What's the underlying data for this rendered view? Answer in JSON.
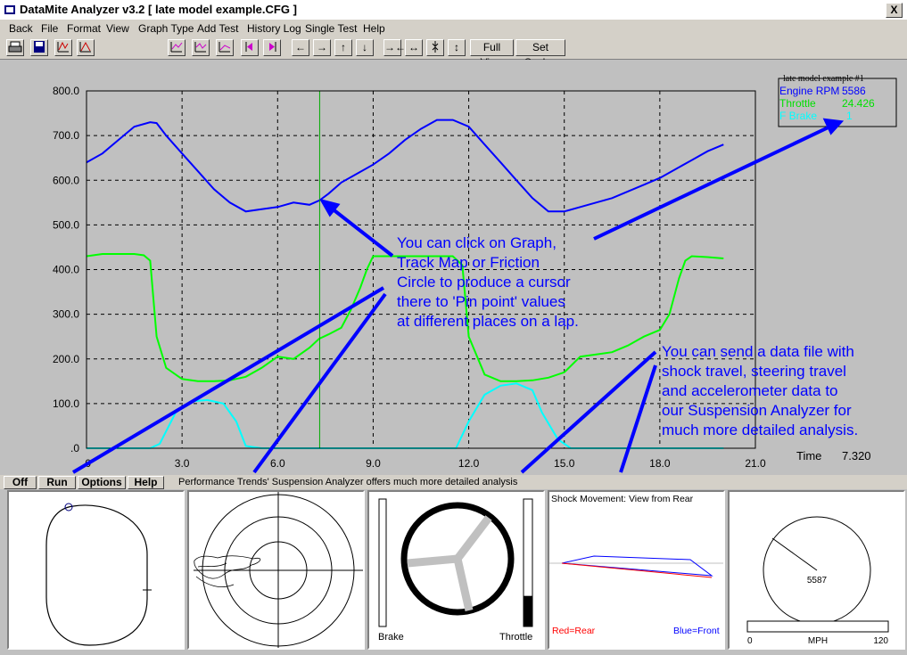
{
  "window": {
    "title": "DataMite Analyzer v3.2  [ late model example.CFG ]",
    "close": "X"
  },
  "menu": [
    "Back",
    "File",
    "Format",
    "View",
    "Graph Type",
    "Add Test",
    "History Log",
    "Single Test",
    "Help"
  ],
  "toolbar": {
    "full_view": "Full View",
    "set_scales": "Set Scales"
  },
  "legend": {
    "title": "late model example  #1",
    "items": [
      {
        "label": "Engine RPM",
        "value": "5586",
        "color": "#0000ff"
      },
      {
        "label": "Throttle",
        "value": "24.426",
        "color": "#00ff00"
      },
      {
        "label": "F Brake",
        "value": "1",
        "color": "#00ffff"
      }
    ]
  },
  "chart_data": {
    "type": "line",
    "xlim": [
      0,
      21
    ],
    "ylim": [
      0,
      800
    ],
    "xticks": [
      ".0",
      "3.0",
      "6.0",
      "9.0",
      "12.0",
      "15.0",
      "18.0",
      "21.0"
    ],
    "yticks": [
      "800.0",
      "700.0",
      "600.0",
      "500.0",
      "400.0",
      "300.0",
      "200.0",
      "100.0",
      ".0"
    ],
    "grid": true,
    "cursor_x": 7.32,
    "series": [
      {
        "name": "Engine RPM",
        "color": "#0000ff",
        "x": [
          0,
          0.5,
          1,
          1.5,
          2,
          2.2,
          2.5,
          3,
          3.5,
          4,
          4.5,
          5,
          5.5,
          6,
          6.5,
          7,
          7.32,
          7.6,
          8,
          8.5,
          9,
          9.5,
          10,
          10.5,
          11,
          11.5,
          12,
          12.5,
          13,
          13.5,
          14,
          14.5,
          15,
          15.5,
          16,
          16.5,
          17,
          17.5,
          18,
          18.5,
          19,
          19.5,
          20
        ],
        "y": [
          640,
          660,
          690,
          720,
          730,
          728,
          700,
          660,
          620,
          580,
          550,
          530,
          535,
          540,
          550,
          545,
          555,
          570,
          595,
          615,
          635,
          660,
          690,
          715,
          735,
          735,
          720,
          680,
          640,
          600,
          560,
          530,
          530,
          540,
          550,
          560,
          575,
          590,
          605,
          625,
          645,
          665,
          680
        ]
      },
      {
        "name": "Throttle",
        "color": "#00ff00",
        "x": [
          0,
          0.5,
          1,
          1.5,
          1.8,
          2,
          2.2,
          2.5,
          3,
          3.5,
          4,
          4.5,
          5,
          5.5,
          6,
          6.5,
          7,
          7.3,
          7.6,
          8,
          8.3,
          8.6,
          8.8,
          9,
          9.5,
          10,
          10.5,
          11,
          11.5,
          11.8,
          12,
          12.5,
          13,
          13.5,
          14,
          14.5,
          15,
          15.5,
          16,
          16.5,
          17,
          17.5,
          18,
          18.3,
          18.6,
          18.8,
          19,
          19.5,
          20
        ],
        "y": [
          430,
          435,
          435,
          435,
          432,
          420,
          250,
          180,
          155,
          150,
          150,
          152,
          160,
          180,
          205,
          200,
          225,
          245,
          255,
          270,
          310,
          360,
          400,
          430,
          430,
          430,
          430,
          430,
          430,
          410,
          250,
          165,
          150,
          150,
          152,
          158,
          170,
          205,
          210,
          215,
          230,
          250,
          265,
          300,
          380,
          420,
          430,
          428,
          425
        ]
      },
      {
        "name": "F Brake",
        "color": "#00ffff",
        "x": [
          0,
          1,
          2,
          2.3,
          2.8,
          3.3,
          3.8,
          4.3,
          4.7,
          5,
          5.5,
          8,
          11,
          11.6,
          12,
          12.5,
          13,
          13.5,
          14,
          14.3,
          14.8,
          15.2,
          16,
          20
        ],
        "y": [
          0,
          0,
          0,
          10,
          80,
          105,
          108,
          100,
          60,
          5,
          0,
          0,
          0,
          0,
          60,
          120,
          140,
          145,
          130,
          80,
          20,
          0,
          0,
          0
        ]
      }
    ]
  },
  "time_readout": {
    "label": "Time",
    "value": "7.320"
  },
  "annotations": {
    "click": [
      "You can click on Graph,",
      "Track Map or Friction",
      "Circle to produce a cursor",
      "there to 'Pin point' values",
      "at different places on a lap."
    ],
    "send": [
      "You can send a data file with",
      "shock travel, steering travel",
      "and accelerometer data to",
      "our Suspension Analyzer for",
      "much more detailed analysis."
    ]
  },
  "bottom": {
    "buttons": [
      "Off",
      "Run",
      "Options",
      "Help"
    ],
    "status": "Performance Trends' Suspension Analyzer offers much more detailed analysis"
  },
  "panels": {
    "pedals": {
      "brake_label": "Brake",
      "throttle_label": "Throttle",
      "brake_level": 0,
      "throttle_level": 0.24
    },
    "shock": {
      "title": "Shock Movement:  View from Rear",
      "red_label": "Red=Rear",
      "blue_label": "Blue=Front"
    },
    "gauge": {
      "value": "5587",
      "min": "0",
      "unit": "MPH",
      "max": "120",
      "speed_level": 0.0
    }
  }
}
